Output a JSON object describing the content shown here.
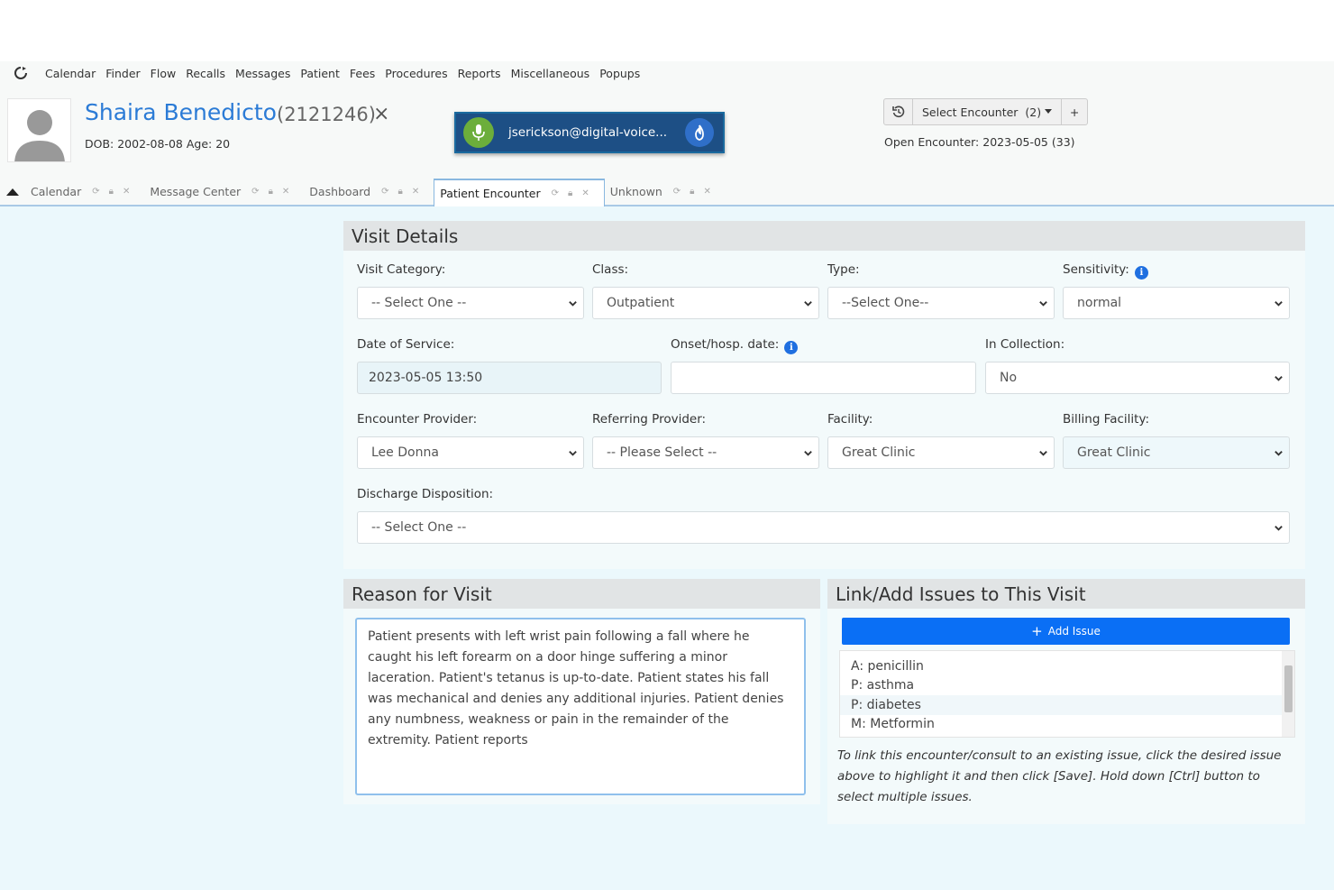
{
  "menu": [
    "Calendar",
    "Finder",
    "Flow",
    "Recalls",
    "Messages",
    "Patient",
    "Fees",
    "Procedures",
    "Reports",
    "Miscellaneous",
    "Popups"
  ],
  "patient": {
    "name": "Shaira Benedicto",
    "id": "(2121246)",
    "close": "×",
    "dob": "DOB: 2002-08-08 Age: 20"
  },
  "voice": {
    "user": "jserickson@digital-voice..."
  },
  "encounter": {
    "select_label": "Select Encounter",
    "count": "(2)",
    "add": "+",
    "open": "Open Encounter: 2023-05-05 (33)"
  },
  "tabs": [
    {
      "label": "Calendar",
      "active": false
    },
    {
      "label": "Message Center",
      "active": false
    },
    {
      "label": "Dashboard",
      "active": false
    },
    {
      "label": "Patient Encounter",
      "active": true
    },
    {
      "label": "Unknown",
      "active": false
    }
  ],
  "visit": {
    "title": "Visit Details",
    "visit_category_label": "Visit Category:",
    "visit_category_value": "-- Select One --",
    "class_label": "Class:",
    "class_value": "Outpatient",
    "type_label": "Type:",
    "type_value": "--Select One--",
    "sensitivity_label": "Sensitivity:",
    "sensitivity_value": "normal",
    "dos_label": "Date of Service:",
    "dos_value": "2023-05-05 13:50",
    "onset_label": "Onset/hosp. date:",
    "onset_value": "",
    "collection_label": "In Collection:",
    "collection_value": "No",
    "provider_label": "Encounter Provider:",
    "provider_value": "Lee Donna",
    "referring_label": "Referring Provider:",
    "referring_value": "-- Please Select --",
    "facility_label": "Facility:",
    "facility_value": "Great Clinic",
    "billing_label": "Billing Facility:",
    "billing_value": "Great Clinic",
    "discharge_label": "Discharge Disposition:",
    "discharge_value": "-- Select One --"
  },
  "reason": {
    "title": "Reason for Visit",
    "text": "Patient presents with left wrist pain following a fall where he caught his left forearm on a door hinge suffering a minor laceration. Patient's tetanus is up-to-date. Patient states his fall was mechanical and denies any additional injuries. Patient denies any numbness, weakness or pain in the remainder of the extremity. Patient reports"
  },
  "issues": {
    "title": "Link/Add Issues to This Visit",
    "add_label": "Add Issue",
    "items": [
      "A: penicillin",
      "P: asthma",
      "P: diabetes",
      "M: Metformin"
    ],
    "note": "To link this encounter/consult to an existing issue, click the desired issue above to highlight it and then click [Save]. Hold down [Ctrl] button to select multiple issues."
  },
  "colors": {
    "accent": "#2b7bd6",
    "primary_button": "#0a6ff5",
    "panel_header": "#e1e4e5",
    "background": "#ebf8fc"
  },
  "icons": [
    "refresh-logo-icon",
    "user-avatar-icon",
    "microphone-icon",
    "fire-icon",
    "history-icon",
    "info-icon",
    "chevron-down-icon",
    "plus-icon",
    "lock-icon",
    "close-icon"
  ]
}
